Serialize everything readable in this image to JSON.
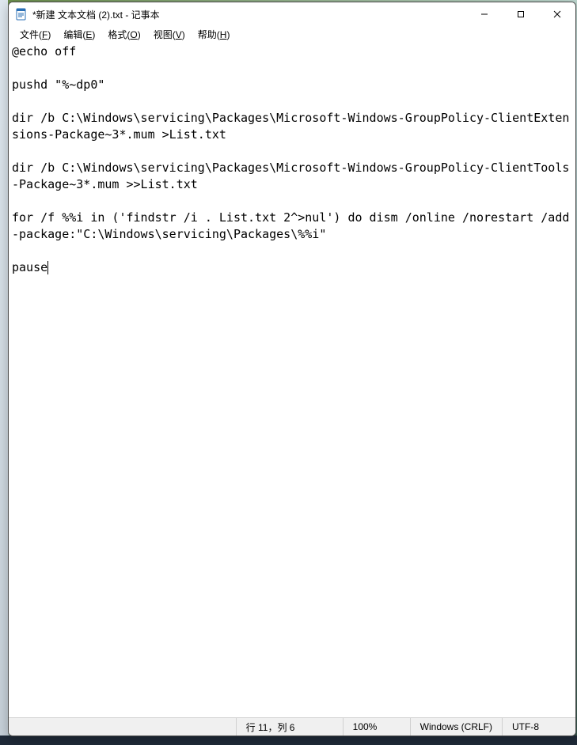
{
  "window": {
    "title": "*新建 文本文档 (2).txt - 记事本"
  },
  "menubar": {
    "file": {
      "label": "文件",
      "mnemonic": "F"
    },
    "edit": {
      "label": "编辑",
      "mnemonic": "E"
    },
    "format": {
      "label": "格式",
      "mnemonic": "O"
    },
    "view": {
      "label": "视图",
      "mnemonic": "V"
    },
    "help": {
      "label": "帮助",
      "mnemonic": "H"
    }
  },
  "editor": {
    "content": "@echo off\n\npushd \"%~dp0\"\n\ndir /b C:\\Windows\\servicing\\Packages\\Microsoft-Windows-GroupPolicy-ClientExtensions-Package~3*.mum >List.txt\n\ndir /b C:\\Windows\\servicing\\Packages\\Microsoft-Windows-GroupPolicy-ClientTools-Package~3*.mum >>List.txt\n\nfor /f %%i in ('findstr /i . List.txt 2^>nul') do dism /online /norestart /add-package:\"C:\\Windows\\servicing\\Packages\\%%i\"\n\npause"
  },
  "statusbar": {
    "position": "行 11，列 6",
    "zoom": "100%",
    "line_ending": "Windows (CRLF)",
    "encoding": "UTF-8"
  }
}
